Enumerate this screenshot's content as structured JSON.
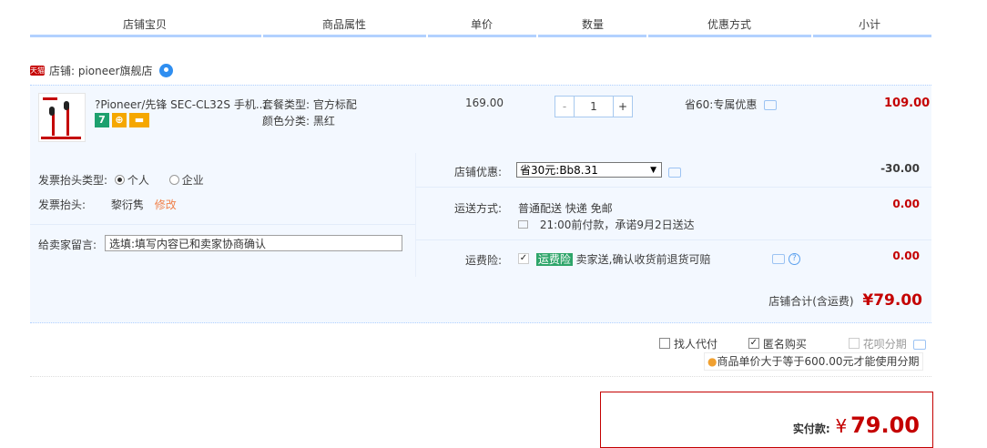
{
  "header": {
    "col_item": "店铺宝贝",
    "col_props": "商品属性",
    "col_price": "单价",
    "col_qty": "数量",
    "col_discount": "优惠方式",
    "col_subtotal": "小计"
  },
  "shop": {
    "tmall_badge": "天猫",
    "label": "店铺: pioneer旗舰店"
  },
  "item": {
    "title": "?Pioneer/先锋 SEC-CL32S 手机...",
    "badges": [
      "7",
      "⊕",
      "▬"
    ],
    "props": [
      "套餐类型: 官方标配",
      "颜色分类: 黑红"
    ],
    "price": "169.00",
    "qty_minus": "-",
    "qty_value": "1",
    "qty_plus": "+",
    "discount": "省60:专属优惠",
    "subtotal": "109.00"
  },
  "invoice": {
    "type_label": "发票抬头类型:",
    "opt_personal": "个人",
    "opt_company": "企业",
    "title_label": "发票抬头:",
    "title_value": "黎衍隽",
    "edit_link": "修改",
    "msg_label": "给卖家留言:",
    "msg_placeholder": "选填:填写内容已和卖家协商确认"
  },
  "shop_discount": {
    "label": "店铺优惠:",
    "selected": "省30元:Bb8.31",
    "amount": "-30.00"
  },
  "shipping": {
    "label": "运送方式:",
    "method": "普通配送 快递 免邮",
    "promise": "21:00前付款，承诺9月2日送达",
    "amount": "0.00"
  },
  "insurance": {
    "label": "运费险:",
    "tag": "运费险",
    "desc": "卖家送,确认收货前退货可赔",
    "help": "?",
    "amount": "0.00"
  },
  "shop_total": {
    "label": "店铺合计(含运费)",
    "value": "¥79.00"
  },
  "options": {
    "proxy_pay": "找人代付",
    "anonymous": "匿名购买",
    "huabei": "花呗分期",
    "huabei_tip": "商品单价大于等于600.00元才能使用分期"
  },
  "pay": {
    "label": "实付款:",
    "currency": "¥",
    "value": "79.00"
  },
  "colors": {
    "accent_red": "#c40000",
    "row_bg": "#f3f8ff",
    "header_line": "#b2d1ff",
    "insurance_green": "#2ea56a"
  }
}
